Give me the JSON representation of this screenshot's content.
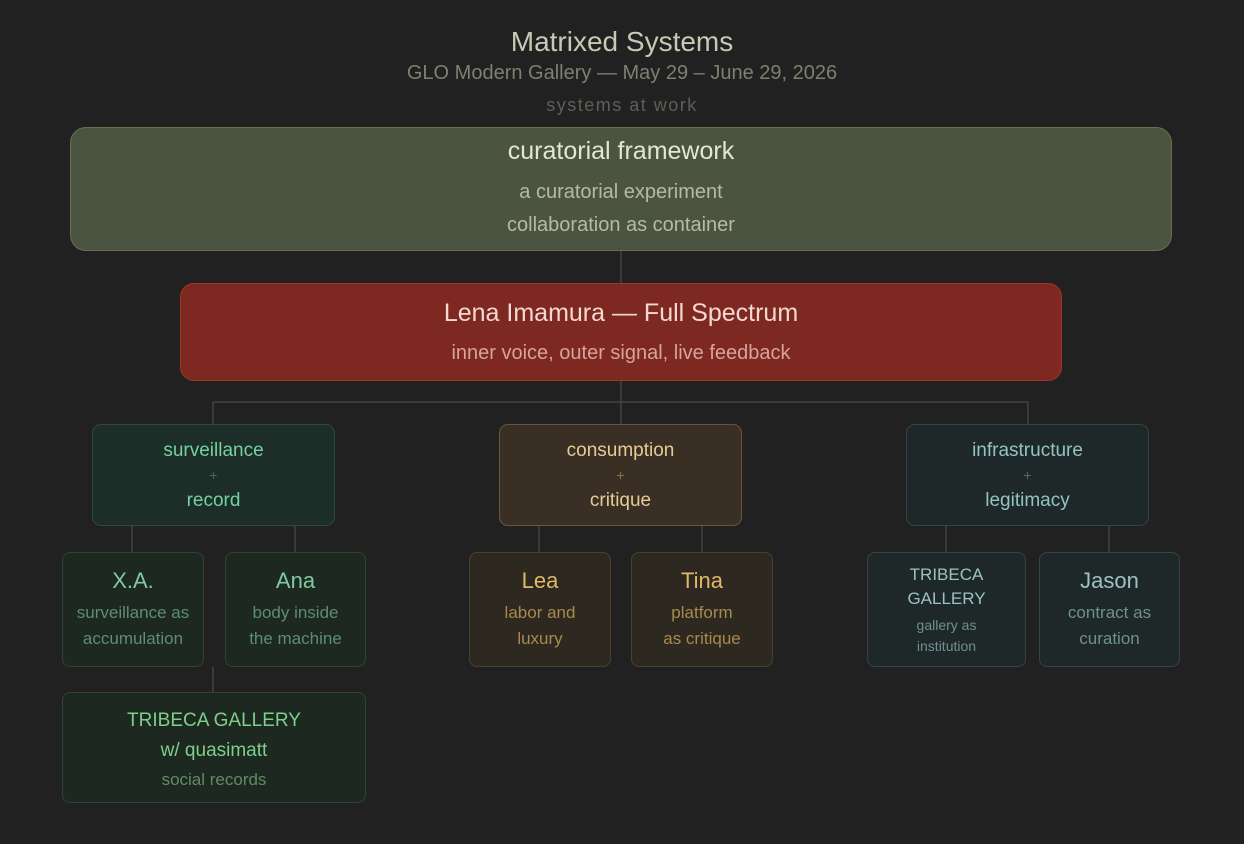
{
  "header": {
    "title": "Matrixed Systems",
    "subtitle": "GLO Modern Gallery — May 29 – June 29, 2026",
    "tagline": "systems at work"
  },
  "framework": {
    "title": "curatorial framework",
    "line1": "a curatorial experiment",
    "line2": "collaboration as container"
  },
  "artist": {
    "title": "Lena Imamura — Full Spectrum",
    "subtitle": "inner voice, outer signal, live feedback"
  },
  "themes": [
    {
      "line1": "surveillance",
      "plus": "+",
      "line2": "record"
    },
    {
      "line1": "consumption",
      "plus": "+",
      "line2": "critique"
    },
    {
      "line1": "infrastructure",
      "plus": "+",
      "line2": "legitimacy"
    }
  ],
  "leaves": {
    "xa": {
      "name": "X.A.",
      "line1": "surveillance as",
      "line2": "accumulation"
    },
    "ana": {
      "name": "Ana",
      "line1": "body inside",
      "line2": "the machine"
    },
    "lea": {
      "name": "Lea",
      "line1": "labor and",
      "line2": "luxury"
    },
    "tina": {
      "name": "Tina",
      "line1": "platform",
      "line2": "as critique"
    },
    "tribeca": {
      "name1": "TRIBECA",
      "name2": "GALLERY",
      "line1": "gallery as",
      "line2": "institution"
    },
    "jason": {
      "name": "Jason",
      "line1": "contract as",
      "line2": "curation"
    }
  },
  "sub": {
    "line1": "TRIBECA GALLERY",
    "line2": "w/ quasimatt",
    "line3": "social records"
  },
  "colors": {
    "background": "#212121",
    "framework": "#4b5440",
    "artist": "#7e2822",
    "surveillance": "#74d1a1",
    "consumption": "#e6cc94",
    "infrastructure": "#93c4bf"
  }
}
